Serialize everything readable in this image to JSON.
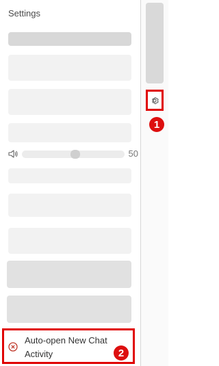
{
  "settings": {
    "title": "Settings",
    "volume": {
      "value": "50",
      "level": 0.5,
      "icon": "speaker-icon"
    },
    "auto_open": {
      "label": "Auto-open New Chat Activity",
      "icon": "circle-x-icon"
    }
  },
  "sidebar": {
    "settings_icon": "gear-icon"
  },
  "annotations": {
    "badge_1": "1",
    "badge_2": "2",
    "highlight_color": "#e00000"
  }
}
